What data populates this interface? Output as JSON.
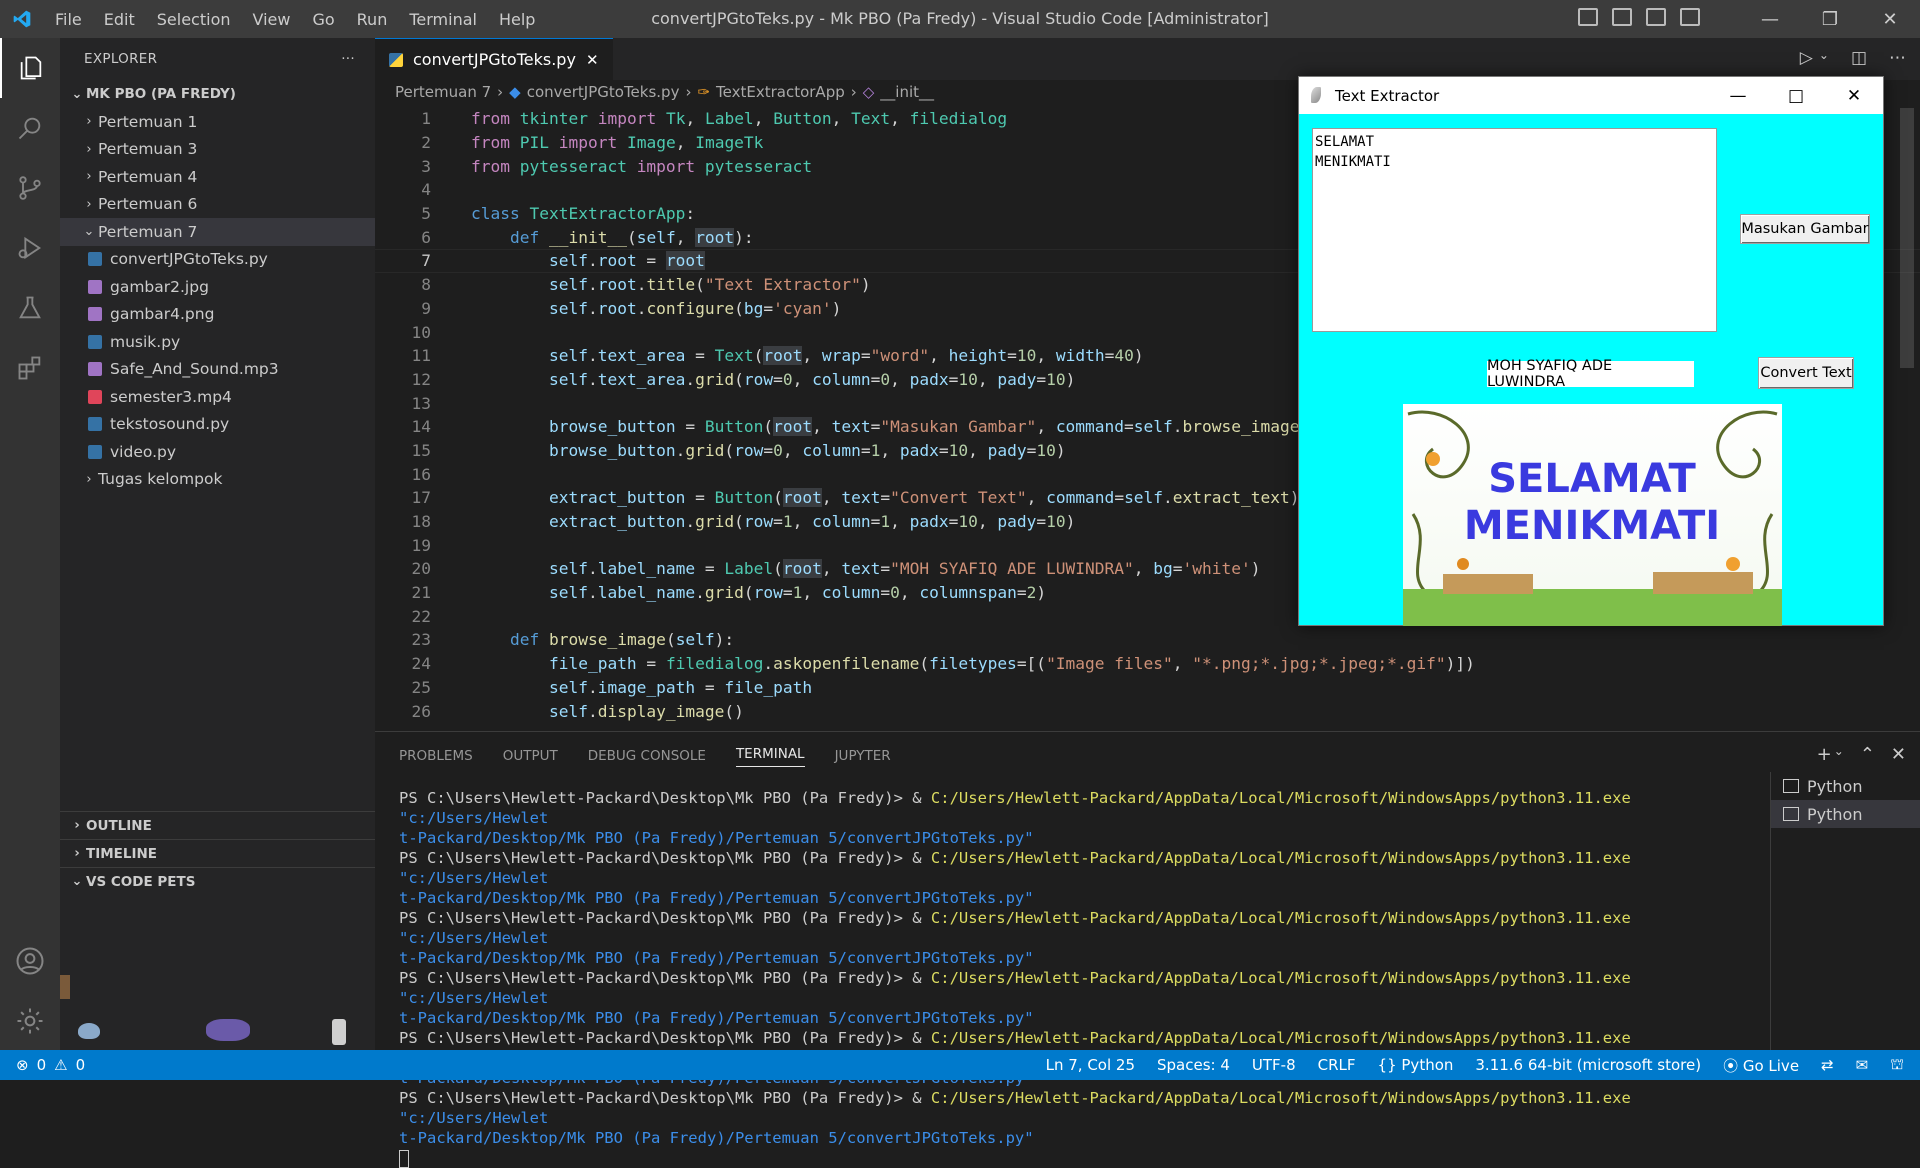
{
  "titlebar": {
    "menu": [
      "File",
      "Edit",
      "Selection",
      "View",
      "Go",
      "Run",
      "Terminal",
      "Help"
    ],
    "window_title": "convertJPGtoTeks.py - Mk PBO (Pa Fredy) - Visual Studio Code [Administrator]"
  },
  "explorer": {
    "header": "EXPLORER",
    "more": "···",
    "folder": "MK PBO (PA FREDY)",
    "items": [
      {
        "label": "Pertemuan 1",
        "type": "folder"
      },
      {
        "label": "Pertemuan 3",
        "type": "folder"
      },
      {
        "label": "Pertemuan 4",
        "type": "folder"
      },
      {
        "label": "Pertemuan 6",
        "type": "folder"
      },
      {
        "label": "Pertemuan 7",
        "type": "folder-open"
      },
      {
        "label": "convertJPGtoTeks.py",
        "type": "py"
      },
      {
        "label": "gambar2.jpg",
        "type": "img"
      },
      {
        "label": "gambar4.png",
        "type": "img"
      },
      {
        "label": "musik.py",
        "type": "py"
      },
      {
        "label": "Safe_And_Sound.mp3",
        "type": "audio"
      },
      {
        "label": "semester3.mp4",
        "type": "video"
      },
      {
        "label": "tekstosound.py",
        "type": "py"
      },
      {
        "label": "video.py",
        "type": "py"
      },
      {
        "label": "Tugas kelompok",
        "type": "folder"
      }
    ],
    "sections": [
      "OUTLINE",
      "TIMELINE",
      "VS CODE PETS"
    ]
  },
  "editor": {
    "tab": "convertJPGtoTeks.py",
    "breadcrumb": [
      "Pertemuan 7",
      "convertJPGtoTeks.py",
      "TextExtractorApp",
      "__init__"
    ],
    "current_line": 7
  },
  "panel": {
    "tabs": [
      "PROBLEMS",
      "OUTPUT",
      "DEBUG CONSOLE",
      "TERMINAL",
      "JUPYTER"
    ],
    "active_tab": "TERMINAL",
    "prompt": "PS C:\\Users\\Hewlett-Packard\\Desktop\\Mk PBO (Pa Fredy)> & ",
    "exe": "C:/Users/Hewlett-Packard/AppData/Local/Microsoft/WindowsApps/python3.11.exe",
    "arg1": " \"c:/Users/Hewlet",
    "arg2": "t-Packard/Desktop/Mk PBO (Pa Fredy)/Pertemuan 5/convertJPGtoTeks.py\"",
    "terminals": [
      "Python",
      "Python"
    ]
  },
  "statusbar": {
    "errors": "0",
    "warnings": "0",
    "position": "Ln 7, Col 25",
    "spaces": "Spaces: 4",
    "encoding": "UTF-8",
    "eol": "CRLF",
    "language": "Python",
    "interpreter": "3.11.6 64-bit (microsoft store)",
    "golive": "Go Live"
  },
  "tk_window": {
    "title": "Text Extractor",
    "text_content": "SELAMAT\nMENIKMATI",
    "browse_button": "Masukan Gambar",
    "convert_button": "Convert Text",
    "name_label": "MOH SYAFIQ ADE LUWINDRA",
    "image_text_1": "SELAMAT",
    "image_text_2": "MENIKMATI"
  },
  "colors": {
    "accent": "#007acc",
    "tk_bg": "#00ffff",
    "image_text": "#3a3adf"
  }
}
